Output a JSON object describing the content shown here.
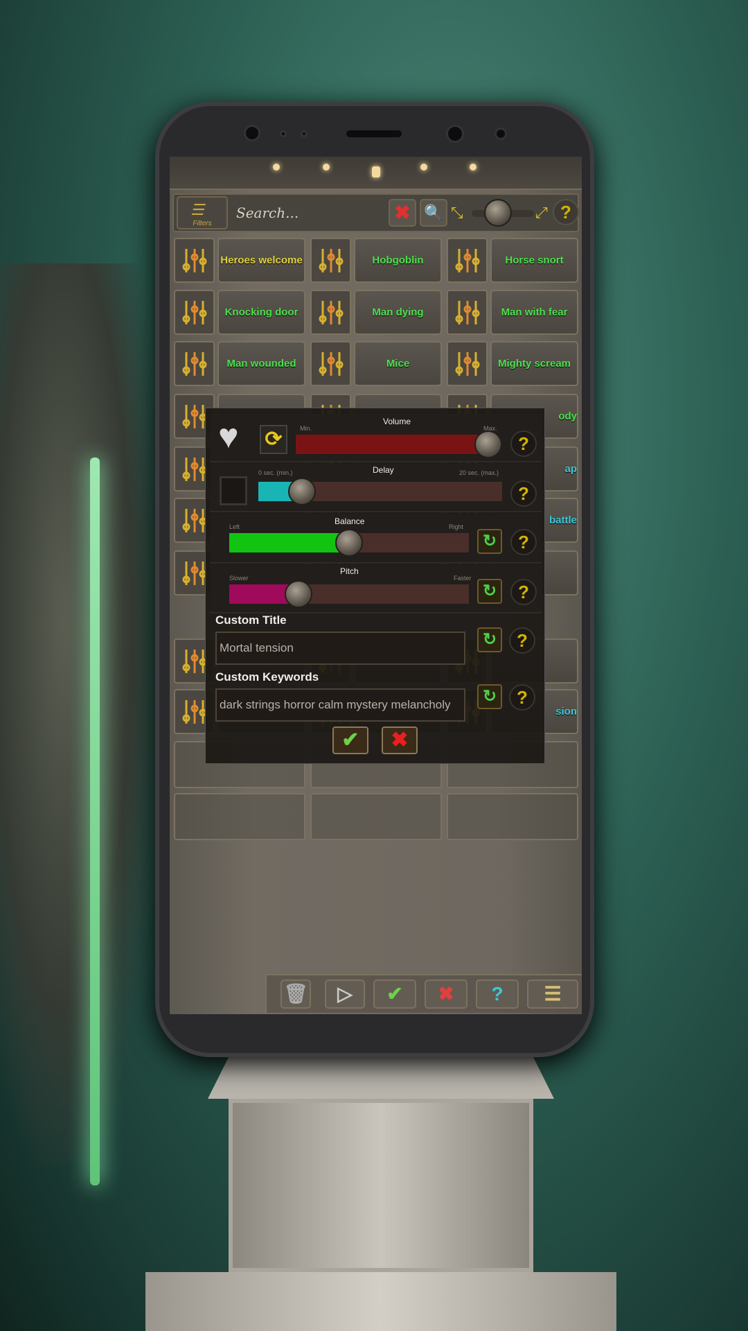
{
  "header": {
    "filters_label": "Filters",
    "search_placeholder": "Search..."
  },
  "grid": {
    "rows": [
      [
        "Heroes welcome",
        "Hobgoblin",
        "Horse snort"
      ],
      [
        "Knocking door",
        "Man dying",
        "Man with fear"
      ],
      [
        "Man wounded",
        "Mice",
        "Mighty scream"
      ],
      [
        "",
        "",
        "ody"
      ],
      [
        "",
        "",
        "ap"
      ],
      [
        "",
        "",
        "battle"
      ],
      [
        "",
        "",
        ""
      ],
      [
        "",
        "",
        ""
      ],
      [
        "",
        "",
        "sion"
      ]
    ],
    "first_label_color": "#e0d040",
    "label_color": "#4ee04e",
    "partial_label_color": "#3cc8d8"
  },
  "modal": {
    "favorite_icon": "heart-icon",
    "loop_icon": "refresh-icon",
    "volume": {
      "label": "Volume",
      "min": "Min.",
      "max": "Max.",
      "value": 0.96,
      "color": "#7a1414"
    },
    "delay": {
      "label": "Delay",
      "min": "0 sec. (min.)",
      "max": "20 sec. (max.)",
      "value": 0.18,
      "color": "#19b5b5"
    },
    "balance": {
      "label": "Balance",
      "min": "Left",
      "max": "Right",
      "value": 0.5,
      "color": "#12c312"
    },
    "pitch": {
      "label": "Pitch",
      "min": "Slower",
      "max": "Faster",
      "value": 0.29,
      "color": "#a00a5a"
    },
    "custom_title_label": "Custom Title",
    "custom_title_value": "Mortal tension",
    "custom_keywords_label": "Custom Keywords",
    "custom_keywords_value": "dark strings horror calm mystery melancholy",
    "help": "?",
    "reset": "↻",
    "confirm": "✔",
    "cancel": "✖"
  },
  "toolbar": {
    "trash": "🗑",
    "play": "▷",
    "confirm": "✔",
    "cancel": "✖",
    "help": "?",
    "menu": "☰"
  }
}
